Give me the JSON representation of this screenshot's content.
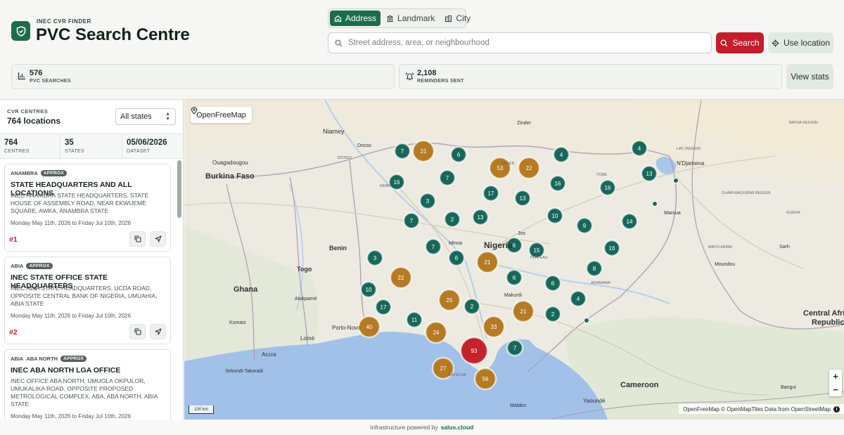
{
  "header": {
    "eyebrow": "INEC CVR FINDER",
    "title": "PVC Search Centre",
    "mode_tabs": [
      {
        "label": "Address",
        "icon": "home-icon",
        "active": true
      },
      {
        "label": "Landmark",
        "icon": "landmark-icon",
        "active": false
      },
      {
        "label": "City",
        "icon": "city-icon",
        "active": false
      }
    ],
    "search_placeholder": "Street address, area, or neighbourhood",
    "search_label": "Search",
    "use_location_label": "Use location",
    "accent": "#1d6b4d",
    "danger": "#c21f2b"
  },
  "stats": {
    "searches": {
      "value": "576",
      "label": "PVC SEARCHES"
    },
    "reminders": {
      "value": "2,108",
      "label": "REMINDERS SENT"
    },
    "view_label": "View stats"
  },
  "sidebar": {
    "eyebrow": "CVR CENTRES",
    "count": "764 locations",
    "state_filter": "All states",
    "summary": [
      {
        "value": "764",
        "label": "CENTRES"
      },
      {
        "value": "35",
        "label": "STATES"
      },
      {
        "value": "05/06/2026",
        "label": "DATASET"
      }
    ],
    "cards": [
      {
        "state": "ANAMBRA",
        "lga": "",
        "badge": "APPROX",
        "title": "STATE HEADQUARTERS AND ALL LOCATIONS",
        "address": "INEC ANAMBRA STATE HEADQUARTERS, STATE HOUSE OF ASSEMBLY ROAD, NEAR EKWUEME SQUARE, AWKA, ANAMBRA STATE",
        "dates": "Monday May 11th, 2026 to Friday Jul 10th, 2026",
        "rank": "#1"
      },
      {
        "state": "ABIA",
        "lga": "",
        "badge": "APPROX",
        "title": "INEC STATE OFFICE STATE HEADQUARTERS",
        "address": "INEC ABIA STATE HEADQUARTERS, UCDA ROAD, OPPOSITE CENTRAL BANK OF NIGERIA, UMUAHIA, ABIA STATE",
        "dates": "Monday May 11th, 2026 to Friday Jul 10th, 2026",
        "rank": "#2"
      },
      {
        "state": "ABIA",
        "lga": "ABA NORTH",
        "badge": "APPROX",
        "title": "INEC ABA NORTH LGA OFFICE",
        "address": "INEC OFFICE ABA NORTH, UMUOLA OKPULOR, UMUKALIKA ROAD, OPPOSITE PROPOSED METROLOGICAL COMPLEX, ABA, ABA NORTH, ABIA STATE",
        "dates": "Monday May 11th, 2026 to Friday Jul 10th, 2026",
        "rank": "#3"
      }
    ]
  },
  "map": {
    "source_label": "OpenFreeMap",
    "attribution": "OpenFreeMap © OpenMapTiles Data from OpenStreetMap",
    "scale_label": "100 km",
    "zoom_in": "+",
    "zoom_out": "−",
    "labels": {
      "niamey": "Niamey",
      "dosso": "Dosso",
      "zinder": "Zinder",
      "ouagadougou": "Ouagadougou",
      "burkina": "Burkina Faso",
      "ndjamena": "N'Djamena",
      "benin": "Benin",
      "nigeria": "Nigeria",
      "togo": "Togo",
      "ghana": "Ghana",
      "porto_novo": "Porto-Novo",
      "lome": "Lomé",
      "accra": "Accra",
      "cameroon": "Cameroon",
      "central_africa": "Central Afri",
      "republic": "Republic",
      "yaounde": "Yaoundé",
      "malabo": "Malabo",
      "bangui": "Bangui",
      "maroua": "Maroua",
      "sarh": "Sarh",
      "moundou": "Moundou",
      "makurdi": "Makurdi",
      "jos": "Jos",
      "minna": "Minna",
      "kumasi": "Kumasi",
      "atakpame": "Atakpamé",
      "sekondi": "Sekondi-Takoradi",
      "lac": "LAC REGION",
      "kebbi": "KEBBI",
      "yobe": "YOBE",
      "plateau": "PLATEAU",
      "bayelsa": "BAYELSA",
      "batha": "BATHA REGION",
      "guera": "GUÉRA",
      "chari": "CHARI-BAGUIRMI REGION",
      "mayo_kebbi": "MAYO-KÉBBI",
      "adamawa": "ADAMAWA",
      "niger_reg": "DOSSO",
      "niger": "NIGER"
    },
    "clusters": [
      {
        "count": 7,
        "kind": "small"
      },
      {
        "count": 21,
        "kind": "medium"
      },
      {
        "count": 6,
        "kind": "small"
      },
      {
        "count": 53,
        "kind": "medium"
      },
      {
        "count": 22,
        "kind": "medium"
      },
      {
        "count": 4,
        "kind": "small"
      },
      {
        "count": 4,
        "kind": "small"
      },
      {
        "count": 13,
        "kind": "small"
      },
      {
        "count": 16,
        "kind": "small"
      },
      {
        "count": 7,
        "kind": "small"
      },
      {
        "count": 17,
        "kind": "small"
      },
      {
        "count": 16,
        "kind": "small"
      },
      {
        "count": 16,
        "kind": "small"
      },
      {
        "count": 3,
        "kind": "small"
      },
      {
        "count": 13,
        "kind": "small"
      },
      {
        "count": 7,
        "kind": "small"
      },
      {
        "count": 2,
        "kind": "small"
      },
      {
        "count": 13,
        "kind": "small"
      },
      {
        "count": 10,
        "kind": "small"
      },
      {
        "count": 9,
        "kind": "small"
      },
      {
        "count": 14,
        "kind": "small"
      },
      {
        "count": 7,
        "kind": "small"
      },
      {
        "count": 6,
        "kind": "small"
      },
      {
        "count": 6,
        "kind": "small"
      },
      {
        "count": 15,
        "kind": "small"
      },
      {
        "count": 16,
        "kind": "small"
      },
      {
        "count": 3,
        "kind": "small"
      },
      {
        "count": 21,
        "kind": "medium"
      },
      {
        "count": 22,
        "kind": "medium"
      },
      {
        "count": 8,
        "kind": "small"
      },
      {
        "count": 6,
        "kind": "small"
      },
      {
        "count": 6,
        "kind": "small"
      },
      {
        "count": 10,
        "kind": "small"
      },
      {
        "count": 25,
        "kind": "medium"
      },
      {
        "count": 2,
        "kind": "small"
      },
      {
        "count": 4,
        "kind": "small"
      },
      {
        "count": 17,
        "kind": "small"
      },
      {
        "count": 21,
        "kind": "medium"
      },
      {
        "count": 2,
        "kind": "small"
      },
      {
        "count": 11,
        "kind": "small"
      },
      {
        "count": 40,
        "kind": "medium"
      },
      {
        "count": 24,
        "kind": "medium"
      },
      {
        "count": 33,
        "kind": "medium"
      },
      {
        "count": 93,
        "kind": "large"
      },
      {
        "count": 7,
        "kind": "small"
      },
      {
        "count": 27,
        "kind": "medium"
      },
      {
        "count": 56,
        "kind": "medium"
      }
    ]
  },
  "footer": {
    "prefix": "infrastructure powered by",
    "brand": "salus.cloud"
  }
}
